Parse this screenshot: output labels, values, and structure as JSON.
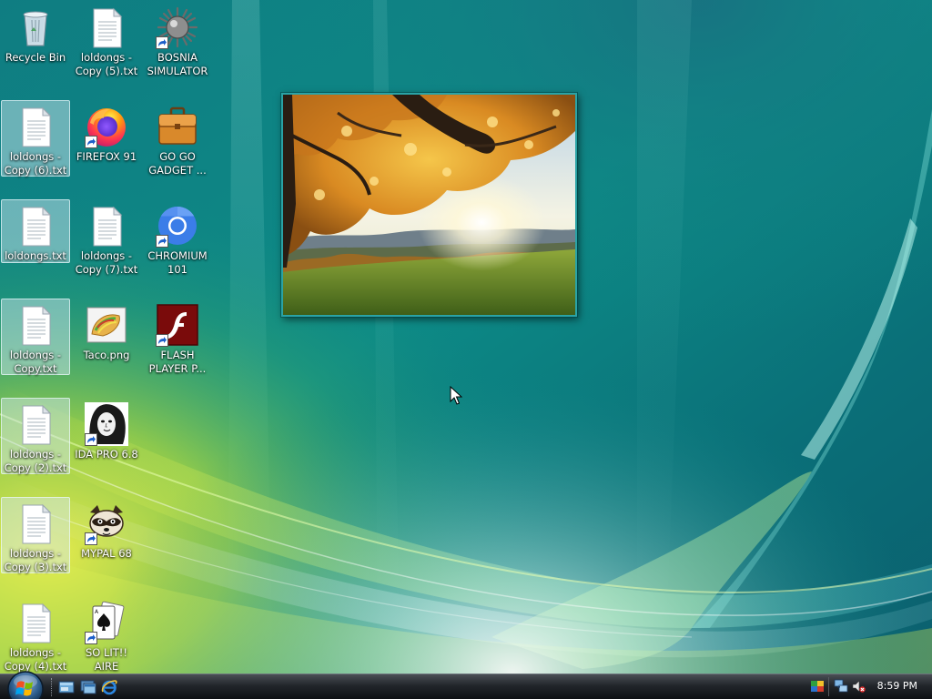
{
  "desktop": {
    "icons": {
      "recycle_bin": "Recycle Bin",
      "loldongs_copy5": "loldongs -\nCopy (5).txt",
      "bosnia_simulator": "BOSNIA\nSIMULATOR",
      "loldongs_copy6": "loldongs -\nCopy (6).txt",
      "firefox": "FIREFOX 91",
      "go_go_gadget": "GO GO\nGADGET ...",
      "loldongs": "loldongs.txt",
      "loldongs_copy7": "loldongs -\nCopy (7).txt",
      "chromium": "CHROMIUM\n101",
      "loldongs_copy": "loldongs -\nCopy.txt",
      "taco": "Taco.png",
      "flash_player": "FLASH\nPLAYER P...",
      "loldongs_copy2": "loldongs -\nCopy (2).txt",
      "ida_pro": "IDA PRO 6.8",
      "loldongs_copy3": "loldongs -\nCopy (3).txt",
      "mypal": "MYPAL 68",
      "loldongs_copy4": "loldongs -\nCopy (4).txt",
      "solitaire": "SO LIT!! AIRE"
    }
  },
  "taskbar": {
    "clock": "8:59 PM",
    "quick_launch": [
      "show-desktop",
      "switch-windows",
      "internet-explorer"
    ],
    "tray_icons": [
      "network-icon",
      "volume-muted-icon"
    ]
  },
  "colors": {
    "wallpaper_base": "#0c6e74",
    "taskbar": "#22262b",
    "gadget_border": "#2aa3a6"
  }
}
